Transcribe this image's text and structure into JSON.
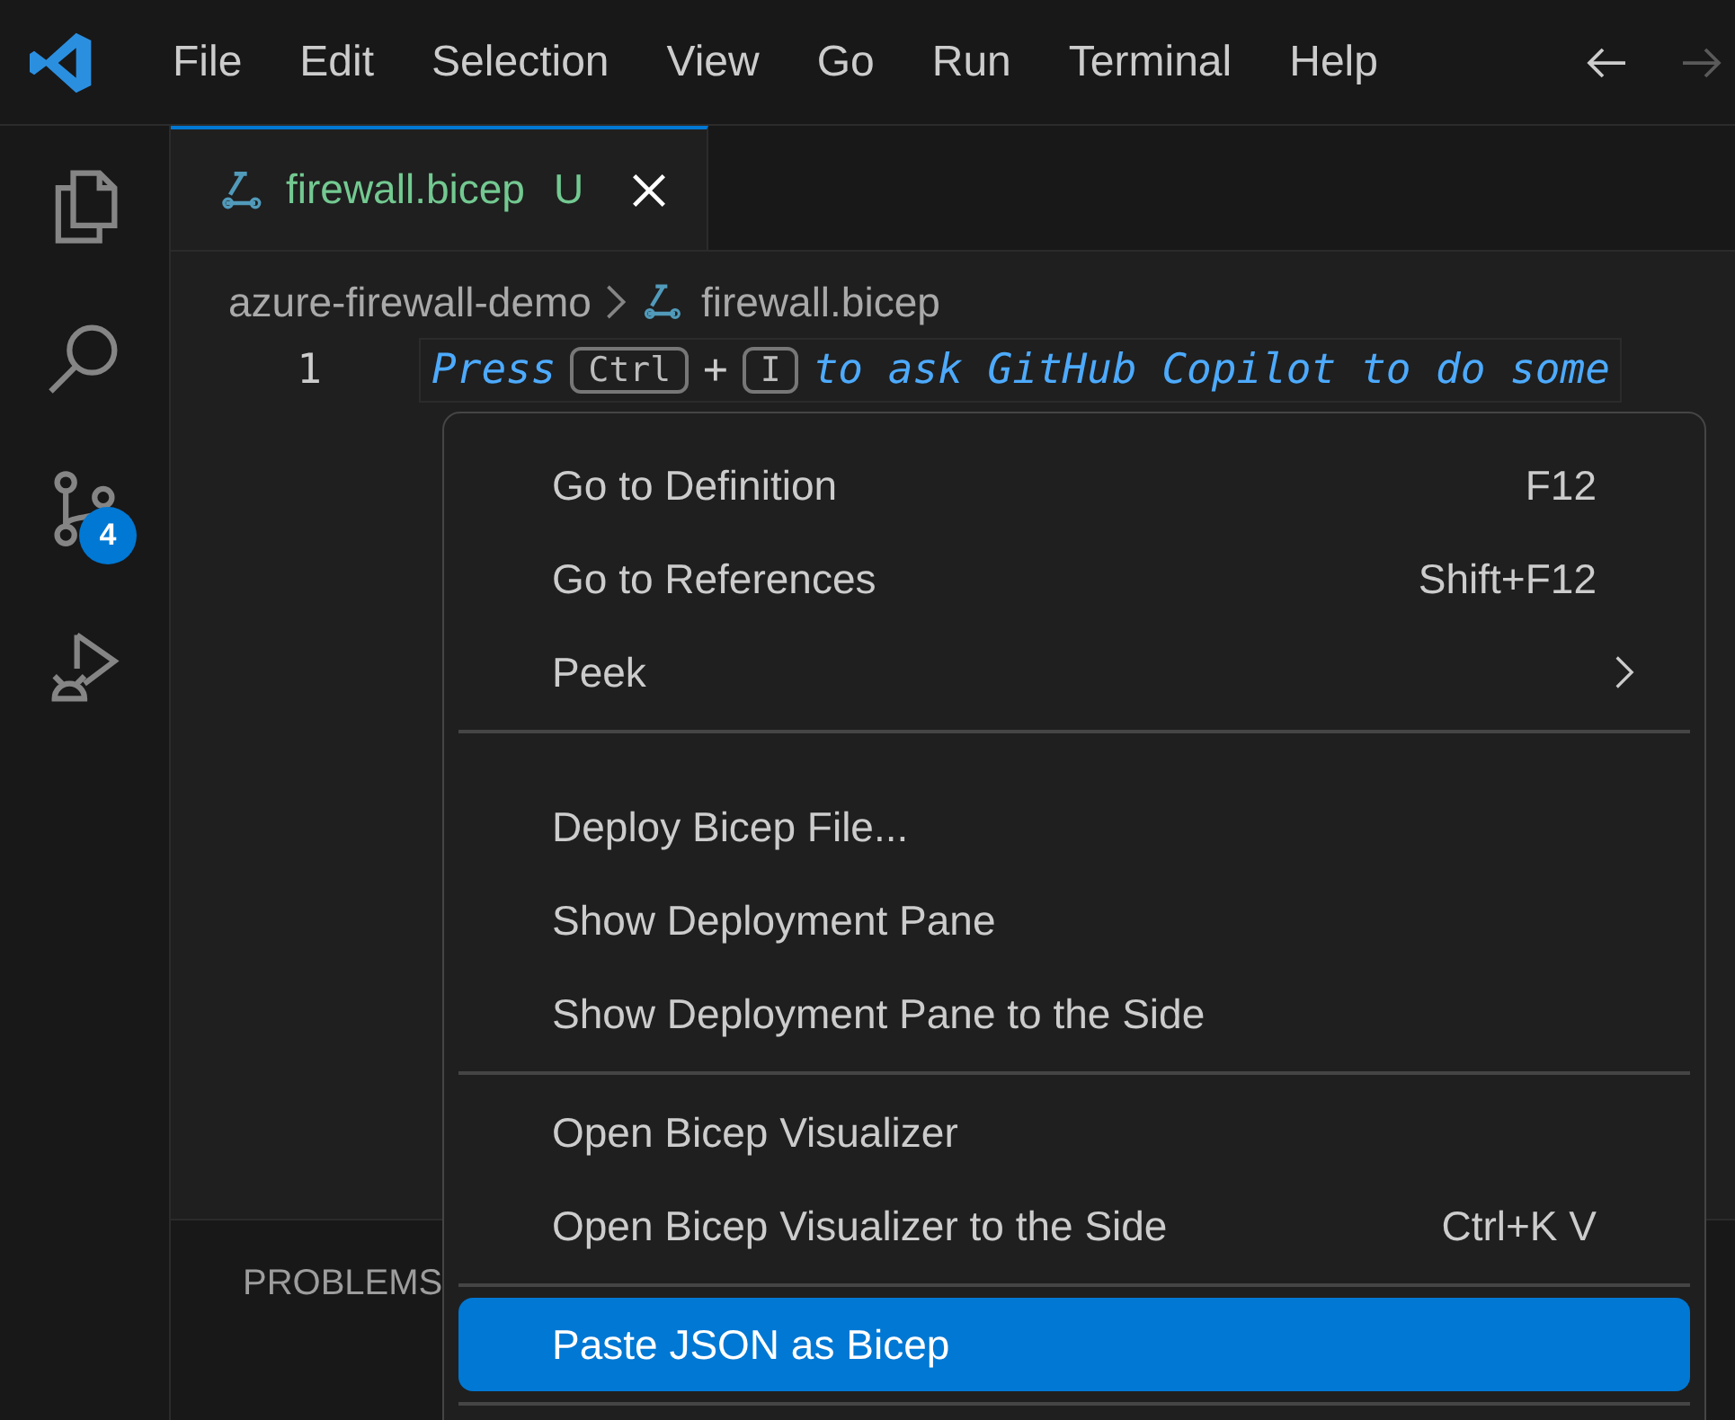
{
  "menu_bar": {
    "items": [
      "File",
      "Edit",
      "Selection",
      "View",
      "Go",
      "Run",
      "Terminal",
      "Help"
    ],
    "back_disabled": false,
    "forward_disabled": true
  },
  "activity_bar": {
    "source_control_badge": "4"
  },
  "tabs": [
    {
      "label": "firewall.bicep",
      "status": "U",
      "selected": true
    }
  ],
  "breadcrumb": {
    "folder": "azure-firewall-demo",
    "file": "firewall.bicep"
  },
  "editor": {
    "line_number": "1",
    "hint_start": "Press",
    "keys": [
      "Ctrl",
      "I"
    ],
    "key_joiner": "+",
    "hint_end": "to ask GitHub Copilot to do some"
  },
  "panel": {
    "tab": "PROBLEMS"
  },
  "context_menu": {
    "groups": [
      [
        {
          "kind": "command",
          "label": "Go to Definition",
          "shortcut": "F12",
          "selected": false
        },
        {
          "kind": "command",
          "label": "Go to References",
          "shortcut": "Shift+F12",
          "selected": false
        },
        {
          "kind": "submenu",
          "label": "Peek",
          "selected": false
        }
      ],
      [
        {
          "kind": "command",
          "label": "Deploy Bicep File...",
          "selected": false
        },
        {
          "kind": "command",
          "label": "Show Deployment Pane",
          "selected": false
        },
        {
          "kind": "command",
          "label": "Show Deployment Pane to the Side",
          "selected": false
        }
      ],
      [
        {
          "kind": "command",
          "label": "Open Bicep Visualizer",
          "selected": false
        },
        {
          "kind": "command",
          "label": "Open Bicep Visualizer to the Side",
          "shortcut": "Ctrl+K V",
          "selected": false
        }
      ],
      [
        {
          "kind": "command",
          "label": "Paste JSON as Bicep",
          "selected": true
        }
      ]
    ]
  }
}
